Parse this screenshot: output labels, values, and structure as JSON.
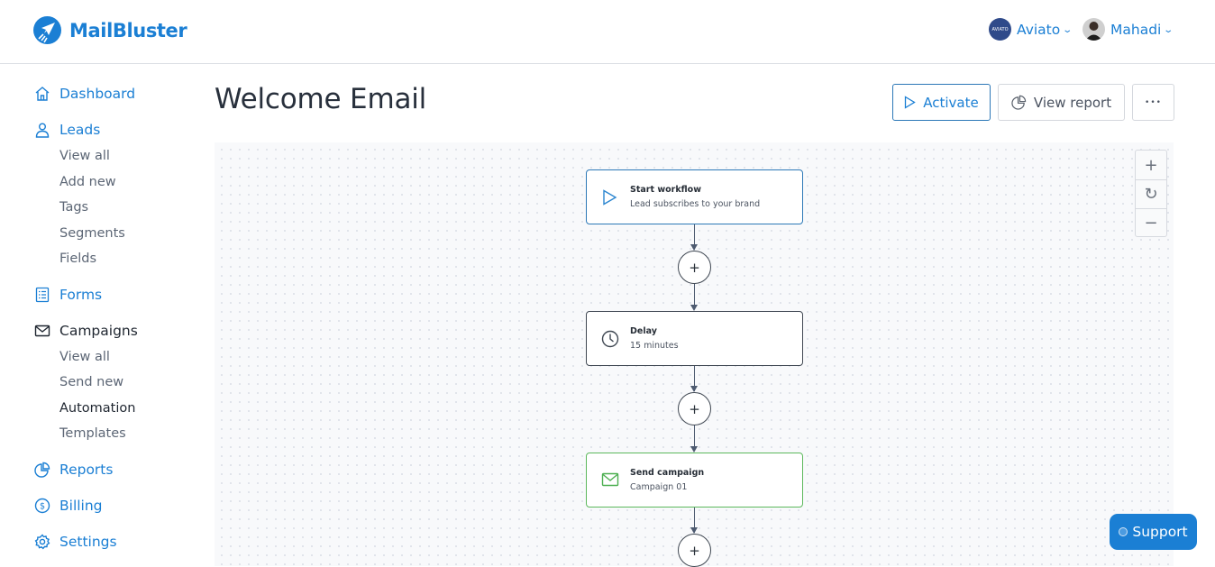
{
  "app": {
    "brand": "MailBluster",
    "brand_color": "#1b7fd4"
  },
  "header": {
    "accounts": [
      {
        "name": "Aviato",
        "avatar_text": "AVIATO",
        "icon": "chevron-down-icon"
      },
      {
        "name": "Mahadi",
        "icon": "chevron-down-icon"
      }
    ]
  },
  "sidebar": {
    "items": [
      {
        "label": "Dashboard",
        "icon": "home-icon"
      },
      {
        "label": "Leads",
        "icon": "user-icon",
        "children": [
          "View all",
          "Add new",
          "Tags",
          "Segments",
          "Fields"
        ]
      },
      {
        "label": "Forms",
        "icon": "form-list-icon"
      },
      {
        "label": "Campaigns",
        "icon": "mail-icon",
        "children": [
          "View all",
          "Send new",
          "Automation",
          "Templates"
        ],
        "active_child": "Automation"
      },
      {
        "label": "Reports",
        "icon": "pie-chart-icon"
      },
      {
        "label": "Billing",
        "icon": "dollar-circle-icon"
      },
      {
        "label": "Settings",
        "icon": "gear-icon"
      }
    ]
  },
  "page": {
    "title": "Welcome Email",
    "actions": {
      "activate": "Activate",
      "view_report": "View report",
      "more": "•••"
    }
  },
  "workflow": {
    "nodes": [
      {
        "title": "Start workflow",
        "subtitle": "Lead subscribes to your brand",
        "icon": "play-icon",
        "border_color": "#2c78b7"
      },
      {
        "title": "Delay",
        "subtitle": "15 minutes",
        "icon": "clock-icon",
        "border_color": "#3f4752"
      },
      {
        "title": "Send campaign",
        "subtitle": "Campaign 01",
        "icon": "mail-icon",
        "border_color": "#5cb85c"
      }
    ],
    "add_step_symbol": "+",
    "zoom_controls": {
      "zoom_in": "+",
      "reset": "↻",
      "zoom_out": "−"
    }
  },
  "support": {
    "label": "Support"
  }
}
